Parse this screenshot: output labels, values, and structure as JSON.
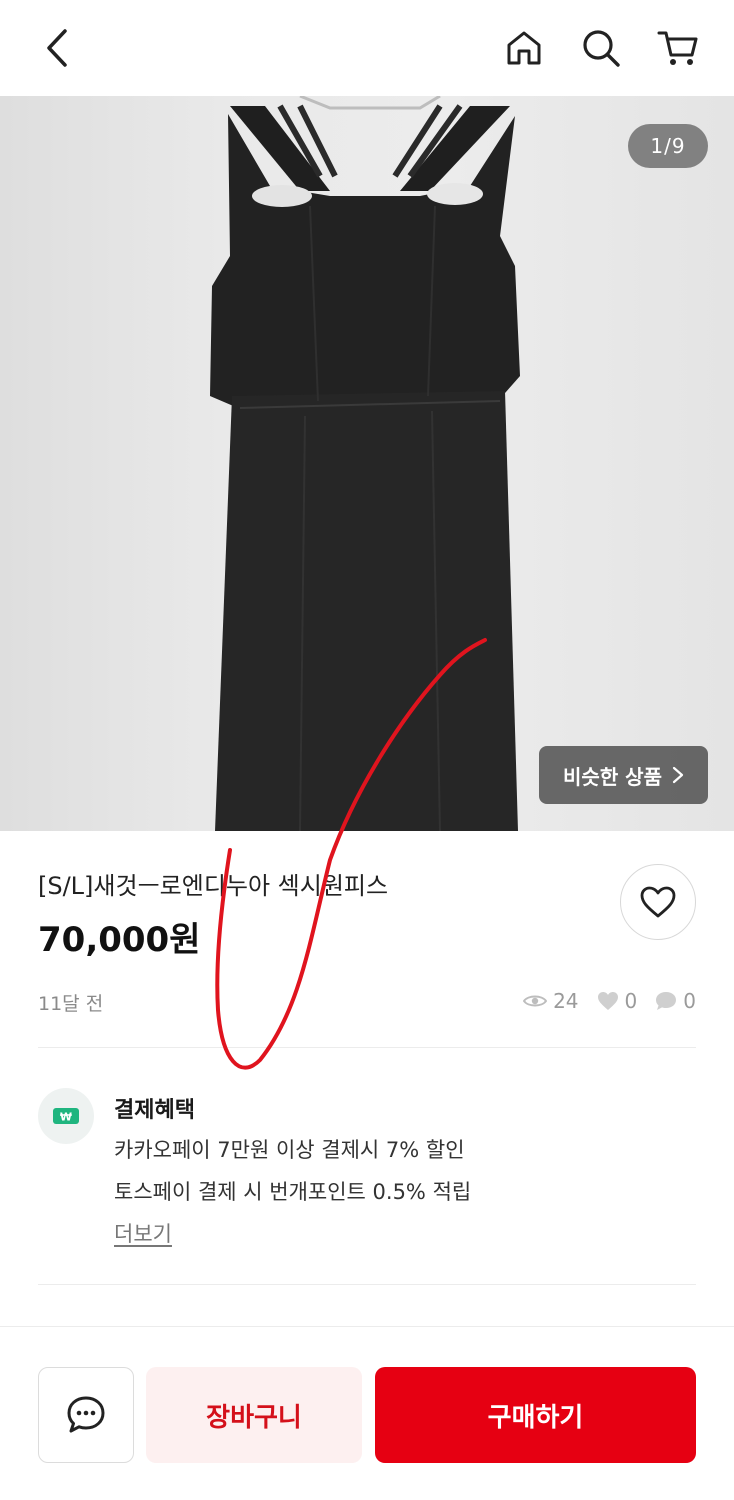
{
  "topbar": {
    "icons": [
      "back-arrow-icon",
      "home-icon",
      "search-icon",
      "cart-icon"
    ]
  },
  "product_image": {
    "counter": "1/9",
    "similar_label": "비슷한 상품"
  },
  "product": {
    "title": "[S/L]새것ㅡ로엔디누아 섹시원피스",
    "price": "70,000원",
    "posted": "11달 전",
    "stats": {
      "views": "24",
      "likes": "0",
      "chats": "0"
    }
  },
  "payment": {
    "title": "결제혜택",
    "lines": [
      "카카오페이 7만원 이상 결제시 7% 할인",
      "토스페이 결제 시 번개포인트 0.5% 적립"
    ],
    "more": "더보기"
  },
  "bottom": {
    "cart_label": "장바구니",
    "buy_label": "구매하기"
  },
  "colors": {
    "accent": "#e60012",
    "cart_bg": "#fdf0f0",
    "annotation": "#e0141e"
  }
}
